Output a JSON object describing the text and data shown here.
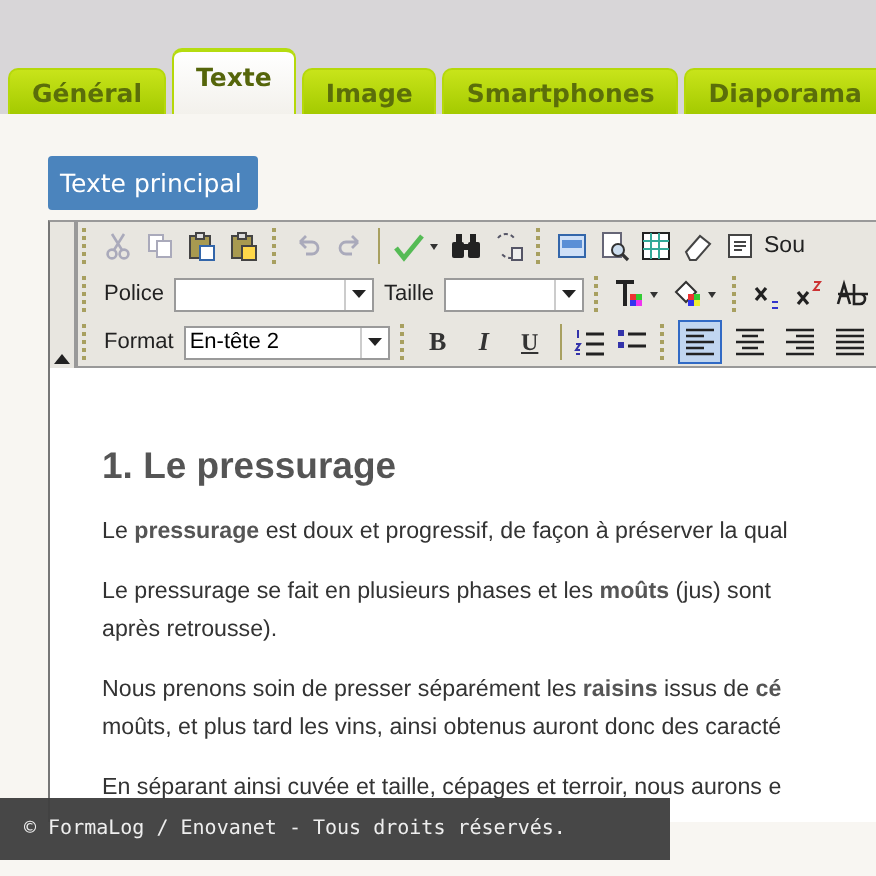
{
  "tabs": [
    {
      "label": "Général",
      "selected": false
    },
    {
      "label": "Texte",
      "selected": true
    },
    {
      "label": "Image",
      "selected": false
    },
    {
      "label": "Smartphones",
      "selected": false
    },
    {
      "label": "Diaporama",
      "selected": false
    }
  ],
  "section_button": "Texte principal",
  "toolbar": {
    "source_label": "Sou",
    "font": {
      "label": "Police"
    },
    "size": {
      "label": "Taille"
    },
    "format": {
      "label": "Format",
      "value": "En-tête 2"
    },
    "style_buttons": [
      "B",
      "I",
      "U"
    ],
    "align_buttons": [
      {
        "selected": true
      },
      {
        "selected": false
      },
      {
        "selected": false
      },
      {
        "selected": false
      }
    ]
  },
  "document": {
    "heading": "1. Le pressurage",
    "paragraphs": [
      [
        "Le **pressurage** est doux et progressif, de façon à préserver la qual"
      ],
      [
        "Le pressurage se fait en plusieurs phases et les **moûts** (jus) sont",
        "après retrousse)."
      ],
      [
        "Nous prenons soin de presser séparément les **raisins** issus de **cé**",
        "moûts, et plus tard les vins, ainsi obtenus auront donc des caracté"
      ],
      [
        "En séparant ainsi cuvée et taille, cépages et terroir, nous aurons e"
      ]
    ]
  },
  "footer_overlay": "© FormaLog / Enovanet - Tous droits réservés."
}
